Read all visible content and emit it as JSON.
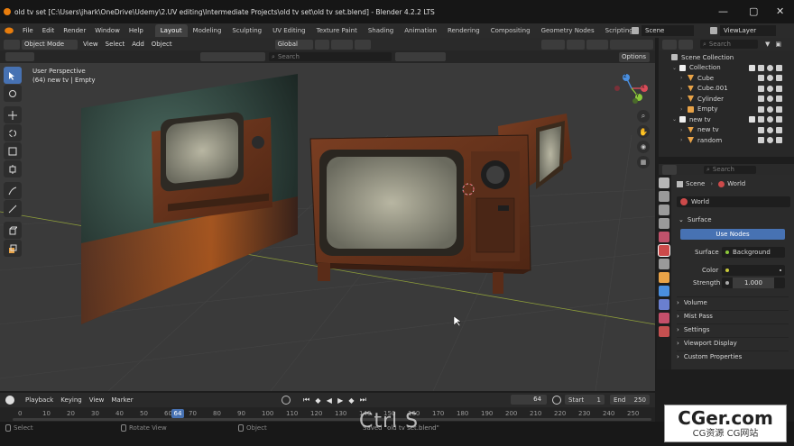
{
  "window": {
    "title": "old tv set [C:\\Users\\jhark\\OneDrive\\Udemy\\2.UV editing\\Intermediate Projects\\old tv set\\old tv set.blend] - Blender 4.2.2 LTS",
    "minimize": "—",
    "maximize": "▢",
    "close": "✕"
  },
  "menubar": {
    "items": [
      "File",
      "Edit",
      "Render",
      "Window",
      "Help"
    ],
    "workspace_tabs": [
      "Layout",
      "Modeling",
      "Sculpting",
      "UV Editing",
      "Texture Paint",
      "Shading",
      "Animation",
      "Rendering",
      "Compositing",
      "Geometry Nodes",
      "Scripting"
    ],
    "active_tab": "Layout",
    "add_tab": "+",
    "scene": "Scene",
    "view_layer": "ViewLayer"
  },
  "viewport_header": {
    "mode": "Object Mode",
    "menus": [
      "View",
      "Select",
      "Add",
      "Object"
    ],
    "transform_orientation": "Global",
    "options": "Options"
  },
  "viewport": {
    "overlay_line1": "User Perspective",
    "overlay_line2": "(64) new tv | Empty",
    "search_placeholder": "Search",
    "gizmo_axes": [
      "X",
      "Y",
      "Z"
    ]
  },
  "timeline": {
    "menus": [
      "Playback",
      "Keying",
      "View",
      "Marker"
    ],
    "current_frame": "64",
    "start_label": "Start",
    "start": "1",
    "end_label": "End",
    "end": "250",
    "ruler_ticks": [
      "0",
      "10",
      "20",
      "30",
      "40",
      "50",
      "60",
      "70",
      "80",
      "90",
      "100",
      "110",
      "120",
      "130",
      "140",
      "150",
      "160",
      "170",
      "180",
      "190",
      "200",
      "210",
      "220",
      "230",
      "240",
      "250"
    ],
    "ruler_current": "64"
  },
  "status": {
    "select": "Select",
    "rotate": "Rotate View",
    "object": "Object",
    "saved": "Saved \"old tv set.blend\"",
    "shortcut": "Ctrl S"
  },
  "outliner": {
    "search_placeholder": "Search",
    "rows": [
      {
        "label": "Scene Collection",
        "depth": 0,
        "type": "scene"
      },
      {
        "label": "Collection",
        "depth": 1,
        "type": "collection"
      },
      {
        "label": "Cube",
        "depth": 2,
        "type": "mesh"
      },
      {
        "label": "Cube.001",
        "depth": 2,
        "type": "mesh"
      },
      {
        "label": "Cylinder",
        "depth": 2,
        "type": "mesh"
      },
      {
        "label": "Empty",
        "depth": 2,
        "type": "empty"
      },
      {
        "label": "new tv",
        "depth": 1,
        "type": "collection"
      },
      {
        "label": "new tv",
        "depth": 2,
        "type": "mesh"
      },
      {
        "label": "random",
        "depth": 2,
        "type": "mesh"
      }
    ]
  },
  "properties": {
    "search_placeholder": "Search",
    "breadcrumb_scene": "Scene",
    "breadcrumb_world": "World",
    "datablock": "World",
    "surface_panel": "Surface",
    "use_nodes": "Use Nodes",
    "surface_label": "Surface",
    "surface_value": "Background",
    "color_label": "Color",
    "strength_label": "Strength",
    "strength_value": "1.000",
    "panels": [
      "Volume",
      "Mist Pass",
      "Settings",
      "Viewport Display",
      "Custom Properties"
    ]
  },
  "watermark": {
    "title": "CGer.com",
    "subtitle": "CG资源 CG网站"
  },
  "colors": {
    "accent": "#4772b3",
    "x_axis": "#d94c59",
    "y_axis": "#8cc83a",
    "z_axis": "#4a8fe0",
    "floor": "#3a3a3a",
    "mesh_icon": "#e9a347",
    "collection_icon": "#f0f0f0"
  }
}
